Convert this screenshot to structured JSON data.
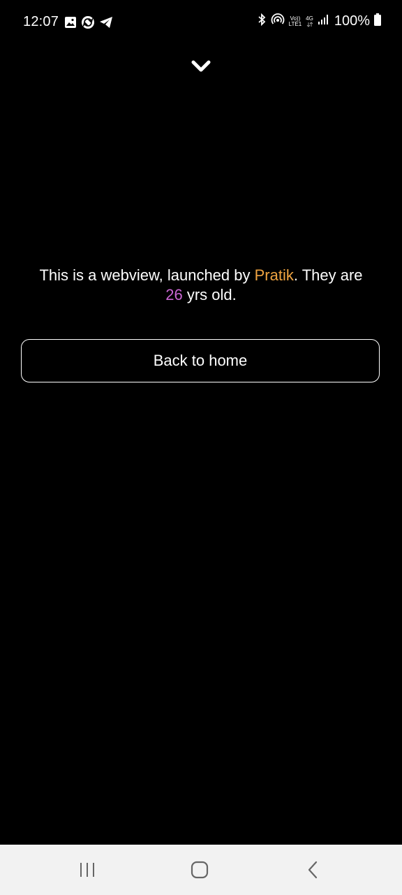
{
  "status_bar": {
    "time": "12:07",
    "battery_text": "100%",
    "network_label": "4G",
    "volte_top": "Vo))",
    "volte_bottom": "LTE1",
    "icons": [
      "image-icon",
      "sync-icon",
      "telegram-icon",
      "bluetooth-icon",
      "hotspot-icon",
      "signal-icon",
      "battery-icon"
    ]
  },
  "collapse": {
    "icon": "chevron-down-icon"
  },
  "message": {
    "prefix": "This is a webview, launched by ",
    "name": "Pratik",
    "middle": ". They are ",
    "age": "26",
    "suffix": " yrs old."
  },
  "colors": {
    "background": "#000000",
    "name_accent": "#f0a441",
    "age_accent": "#c966d2",
    "nav_bar": "#f2f2f2"
  },
  "back_button": {
    "label": "Back to home"
  },
  "nav_bar": {
    "items": [
      "recent-apps-icon",
      "home-icon",
      "back-icon"
    ]
  }
}
